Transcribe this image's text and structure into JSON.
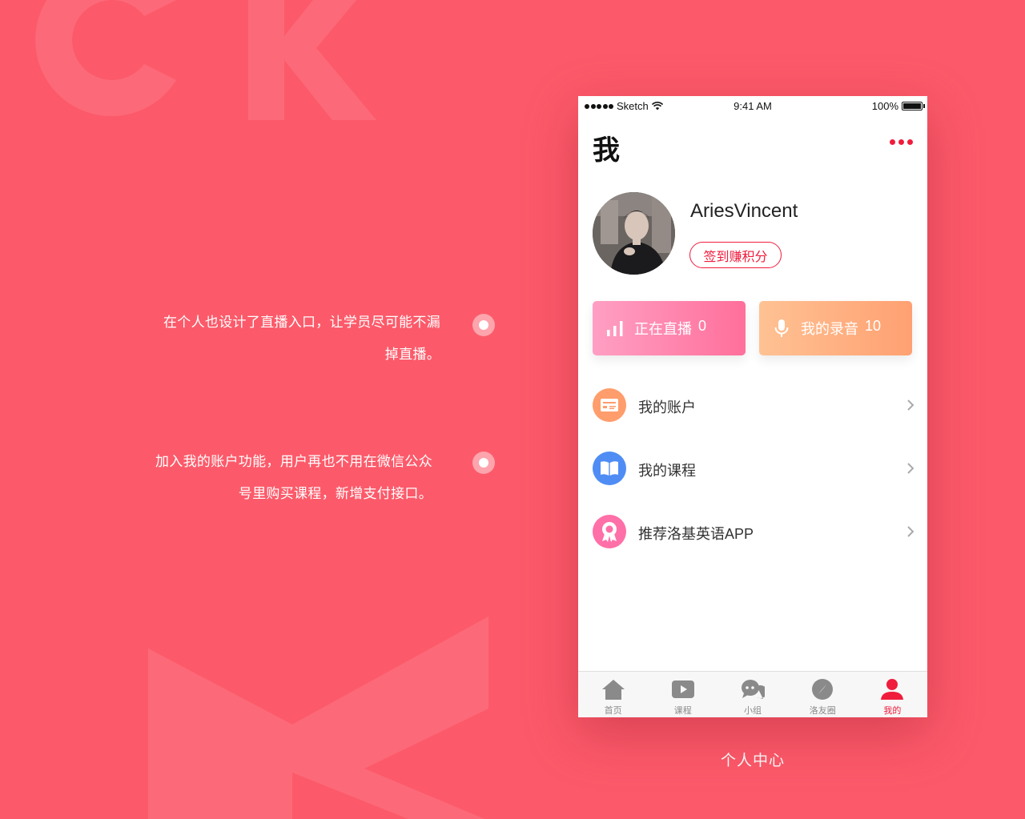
{
  "colors": {
    "background": "#fc5a6a",
    "accent": "#f01c3c",
    "live_card_gradient": [
      "#ff9fc3",
      "#ff6f9b"
    ],
    "record_card_gradient": [
      "#ffc293",
      "#ffa072"
    ],
    "account_icon": "#ff9d6c",
    "course_icon": "#4f8df5",
    "recommend_icon": "#ff6fa8"
  },
  "annotations": [
    {
      "lines": [
        "在个人也设计了直播入口，让学员尽可能不漏",
        "掉直播。"
      ]
    },
    {
      "lines": [
        "加入我的账户功能，用户再也不用在微信公众",
        "号里购买课程，新增支付接口。"
      ]
    }
  ],
  "caption": "个人中心",
  "status_bar": {
    "carrier": "Sketch",
    "time": "9:41 AM",
    "battery": "100%"
  },
  "header": {
    "title": "我",
    "more_icon": "more-dots-icon"
  },
  "profile": {
    "username": "AriesVincent",
    "checkin_label": "签到赚积分"
  },
  "cards": {
    "live": {
      "icon": "bar-chart-icon",
      "label": "正在直播",
      "count": "0"
    },
    "recording": {
      "icon": "microphone-icon",
      "label": "我的录音",
      "count": "10"
    }
  },
  "menu": {
    "items": [
      {
        "icon": "card-icon",
        "label": "我的账户"
      },
      {
        "icon": "book-icon",
        "label": "我的课程"
      },
      {
        "icon": "badge-icon",
        "label": "推荐洛基英语APP"
      }
    ]
  },
  "tabs": [
    {
      "icon": "home-icon",
      "label": "首页",
      "active": false
    },
    {
      "icon": "play-icon",
      "label": "课程",
      "active": false
    },
    {
      "icon": "chat-icon",
      "label": "小组",
      "active": false
    },
    {
      "icon": "compass-icon",
      "label": "洛友圈",
      "active": false
    },
    {
      "icon": "user-icon",
      "label": "我的",
      "active": true
    }
  ]
}
